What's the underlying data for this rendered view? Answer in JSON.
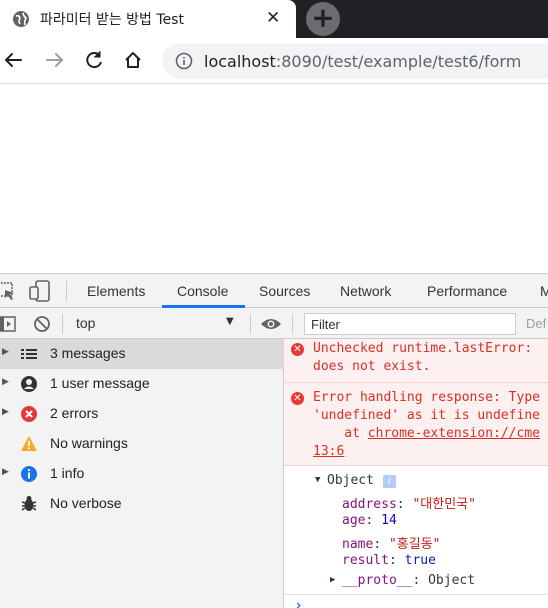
{
  "browser": {
    "tab_title": "파라미터 받는 방법 Test",
    "tab_close": "✕",
    "new_tab": "+",
    "url_host": "localhost",
    "url_path": ":8090/test/example/test6/form"
  },
  "devtools": {
    "tabs": [
      "Elements",
      "Console",
      "Sources",
      "Network",
      "Performance",
      "M"
    ],
    "active_tab": "Console",
    "context": "top",
    "context_caret": "▼",
    "filter_placeholder": "Filter",
    "default_levels": "Def",
    "sidebar": [
      {
        "label": "3 messages",
        "icon": "list-icon"
      },
      {
        "label": "1 user message",
        "icon": "user-icon"
      },
      {
        "label": "2 errors",
        "icon": "error-icon"
      },
      {
        "label": "No warnings",
        "icon": "warning-icon"
      },
      {
        "label": "1 info",
        "icon": "info-icon"
      },
      {
        "label": "No verbose",
        "icon": "bug-icon"
      }
    ],
    "console": {
      "error1": [
        "Unchecked runtime.lastError: ",
        "does not exist."
      ],
      "error2": [
        "Error handling response: Type",
        "'undefined' as it is undefine",
        "    at ",
        "chrome-extension://cme",
        "13:6"
      ],
      "object_label": "Object",
      "object_info": "i",
      "props": [
        {
          "key": "address",
          "value": "\"대한민국\"",
          "type": "string"
        },
        {
          "key": "age",
          "value": "14",
          "type": "number"
        },
        {
          "key": "name",
          "value": "\"홍길동\"",
          "type": "string"
        },
        {
          "key": "result",
          "value": "true",
          "type": "keyword"
        }
      ],
      "proto_key": "__proto__",
      "proto_value": "Object",
      "prompt": "›"
    }
  },
  "colors": {
    "accent": "#1a73e8",
    "error": "#d93025",
    "error_bg": "#fdf0f0"
  }
}
